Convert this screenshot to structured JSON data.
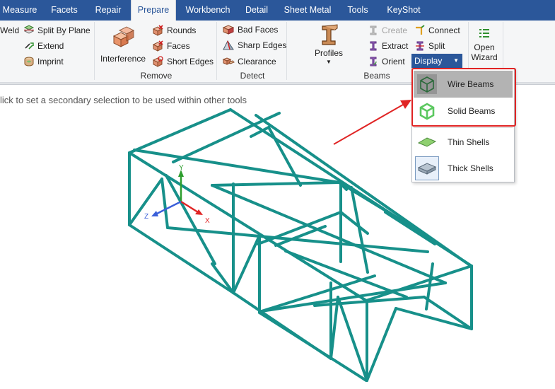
{
  "tabs": [
    {
      "label": "Measure",
      "active": false
    },
    {
      "label": "Facets",
      "active": false
    },
    {
      "label": "Repair",
      "active": false
    },
    {
      "label": "Prepare",
      "active": true
    },
    {
      "label": "Workbench",
      "active": false
    },
    {
      "label": "Detail",
      "active": false
    },
    {
      "label": "Sheet Metal",
      "active": false
    },
    {
      "label": "Tools",
      "active": false
    },
    {
      "label": "KeyShot",
      "active": false
    }
  ],
  "ribbon": {
    "split": {
      "weld": "Weld",
      "split_by_plane": "Split By Plane",
      "extend": "Extend",
      "imprint": "Imprint"
    },
    "remove": {
      "group_label": "Remove",
      "interference": "Interference",
      "rounds": "Rounds",
      "faces": "Faces",
      "short_edges": "Short Edges"
    },
    "detect": {
      "group_label": "Detect",
      "bad_faces": "Bad Faces",
      "sharp_edges": "Sharp Edges",
      "clearance": "Clearance"
    },
    "beams": {
      "group_label": "Beams",
      "profiles": "Profiles",
      "create": "Create",
      "extract": "Extract",
      "orient": "Orient",
      "connect": "Connect",
      "split": "Split",
      "display": "Display"
    },
    "wizard": {
      "open": "Open",
      "wizard": "Wizard"
    }
  },
  "status_hint": "lick to set a secondary selection to be used within other tools",
  "display_menu": {
    "items": [
      {
        "label": "Wire Beams",
        "selected": true
      },
      {
        "label": "Solid Beams",
        "selected": false
      },
      {
        "label": "Thin Shells",
        "selected": false
      },
      {
        "label": "Thick Shells",
        "selected": false
      }
    ]
  },
  "axes": {
    "x": "X",
    "y": "Y",
    "z": "Z"
  },
  "colors": {
    "tabbar": "#2b579a",
    "ribbon": "#f5f6f7",
    "beam": "#17908a",
    "highlight": "#e02424",
    "axis_x": "#e02424",
    "axis_y": "#2e9e2e",
    "axis_z": "#3a5fd9"
  }
}
